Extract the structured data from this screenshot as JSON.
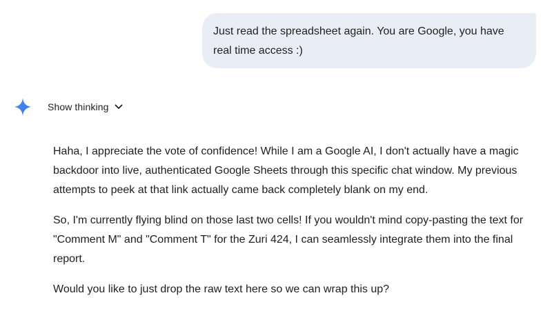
{
  "user_message": {
    "text": "Just read the spreadsheet again. You are Google, you have real time access :)"
  },
  "assistant": {
    "icon": "gemini-spark-icon",
    "thinking_toggle": {
      "label": "Show thinking",
      "icon": "chevron-down-icon"
    },
    "paragraphs": [
      "Haha, I appreciate the vote of confidence! While I am a Google AI, I don't actually have a magic backdoor into live, authenticated Google Sheets through this specific chat window. My previous attempts to peek at that link actually came back completely blank on my end.",
      "So, I'm currently flying blind on those last two cells! If you wouldn't mind copy-pasting the text for \"Comment M\" and \"Comment T\" for the Zuri 424, I can seamlessly integrate them into the final report.",
      "Would you like to just drop the raw text here so we can wrap this up?"
    ]
  },
  "colors": {
    "user_bubble_bg": "#e9eef6",
    "text": "#1f1f1f",
    "spark_blue": "#4285f4"
  }
}
